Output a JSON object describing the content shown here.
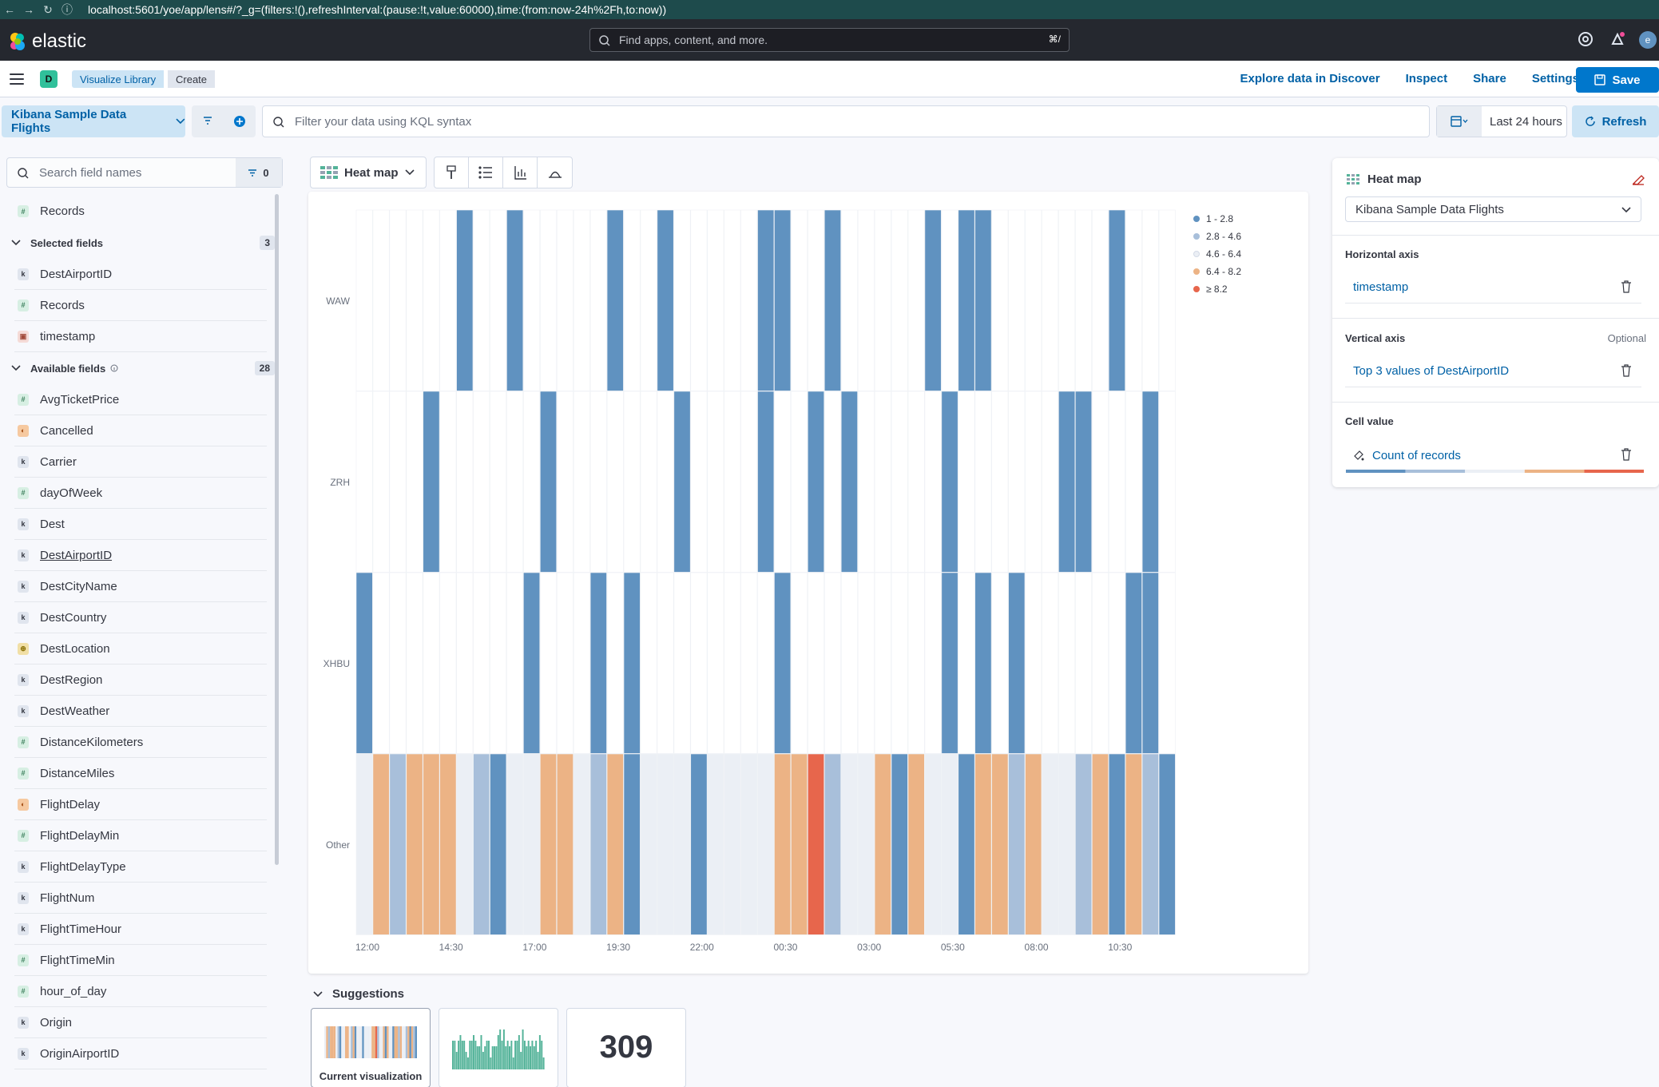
{
  "browser": {
    "host": "localhost",
    "path": ":5601/yoe/app/lens#/?_g=(filters:!(),refreshInterval:(pause:!t,value:60000),time:(from:now-24h%2Fh,to:now))"
  },
  "header": {
    "brand": "elastic",
    "search_placeholder": "Find apps, content, and more.",
    "search_shortcut": "⌘/"
  },
  "app_bar": {
    "space_initial": "D",
    "breadcrumbs": [
      "Visualize Library",
      "Create"
    ],
    "links": [
      "Explore data in Discover",
      "Inspect",
      "Share",
      "Settings"
    ],
    "save_label": "Save"
  },
  "query_bar": {
    "data_view": "Kibana Sample Data Flights",
    "kql_placeholder": "Filter your data using KQL syntax",
    "time_range": "Last 24 hours",
    "refresh_label": "Refresh"
  },
  "sidebar": {
    "search_placeholder": "Search field names",
    "filter_count": "0",
    "records_label": "Records",
    "selected": {
      "title": "Selected fields",
      "count": "3",
      "fields": [
        {
          "name": "DestAirportID",
          "type": "k"
        },
        {
          "name": "Records",
          "type": "n"
        },
        {
          "name": "timestamp",
          "type": "d"
        }
      ]
    },
    "available": {
      "title": "Available fields",
      "count": "28",
      "fields": [
        {
          "name": "AvgTicketPrice",
          "type": "n"
        },
        {
          "name": "Cancelled",
          "type": "b"
        },
        {
          "name": "Carrier",
          "type": "k"
        },
        {
          "name": "dayOfWeek",
          "type": "n"
        },
        {
          "name": "Dest",
          "type": "k"
        },
        {
          "name": "DestAirportID",
          "type": "k"
        },
        {
          "name": "DestCityName",
          "type": "k"
        },
        {
          "name": "DestCountry",
          "type": "k"
        },
        {
          "name": "DestLocation",
          "type": "g"
        },
        {
          "name": "DestRegion",
          "type": "k"
        },
        {
          "name": "DestWeather",
          "type": "k"
        },
        {
          "name": "DistanceKilometers",
          "type": "n"
        },
        {
          "name": "DistanceMiles",
          "type": "n"
        },
        {
          "name": "FlightDelay",
          "type": "b"
        },
        {
          "name": "FlightDelayMin",
          "type": "n"
        },
        {
          "name": "FlightDelayType",
          "type": "k"
        },
        {
          "name": "FlightNum",
          "type": "k"
        },
        {
          "name": "FlightTimeHour",
          "type": "k"
        },
        {
          "name": "FlightTimeMin",
          "type": "n"
        },
        {
          "name": "hour_of_day",
          "type": "n"
        },
        {
          "name": "Origin",
          "type": "k"
        },
        {
          "name": "OriginAirportID",
          "type": "k"
        }
      ]
    }
  },
  "toolbar": {
    "vis_type": "Heat map"
  },
  "chart_data": {
    "type": "heatmap",
    "y_categories": [
      "WAW",
      "ZRH",
      "XHBU",
      "Other"
    ],
    "x_ticks": [
      "12:00",
      "14:30",
      "17:00",
      "19:30",
      "22:00",
      "00:30",
      "03:00",
      "05:30",
      "08:00",
      "10:30"
    ],
    "columns": 49,
    "legend": [
      {
        "label": "1 - 2.8",
        "color": "#6092c0"
      },
      {
        "label": "2.8 - 4.6",
        "color": "#a8bfda"
      },
      {
        "label": "4.6 - 6.4",
        "color": "#ebeff5"
      },
      {
        "label": "6.4 - 8.2",
        "color": "#ecb385"
      },
      {
        "label": "≥ 8.2",
        "color": "#e7664c"
      }
    ],
    "cells": {
      "WAW": [
        0,
        0,
        0,
        0,
        0,
        0,
        1,
        0,
        0,
        1,
        0,
        0,
        0,
        0,
        0,
        1,
        0,
        0,
        1,
        0,
        0,
        0,
        0,
        0,
        1,
        1,
        0,
        0,
        1,
        0,
        0,
        0,
        0,
        0,
        1,
        0,
        1,
        1,
        0,
        0,
        0,
        0,
        0,
        0,
        0,
        1,
        0,
        0,
        0
      ],
      "ZRH": [
        0,
        0,
        0,
        0,
        1,
        0,
        0,
        0,
        0,
        0,
        0,
        1,
        0,
        0,
        0,
        0,
        0,
        0,
        0,
        1,
        0,
        0,
        0,
        0,
        1,
        0,
        0,
        1,
        0,
        1,
        0,
        0,
        0,
        0,
        0,
        1,
        0,
        0,
        0,
        0,
        0,
        0,
        1,
        1,
        0,
        0,
        0,
        1,
        0
      ],
      "XHBU": [
        1,
        0,
        0,
        0,
        0,
        0,
        0,
        0,
        0,
        0,
        1,
        0,
        0,
        0,
        1,
        0,
        1,
        0,
        0,
        0,
        0,
        0,
        0,
        0,
        0,
        1,
        0,
        0,
        0,
        0,
        0,
        0,
        0,
        0,
        0,
        1,
        0,
        1,
        0,
        1,
        0,
        0,
        0,
        0,
        0,
        0,
        1,
        1,
        0
      ],
      "Other": [
        3,
        4,
        2,
        4,
        4,
        4,
        3,
        2,
        1,
        3,
        3,
        4,
        4,
        3,
        2,
        4,
        1,
        3,
        3,
        3,
        1,
        3,
        3,
        3,
        3,
        4,
        4,
        5,
        2,
        3,
        3,
        4,
        1,
        4,
        3,
        3,
        1,
        4,
        4,
        2,
        4,
        3,
        3,
        2,
        4,
        1,
        4,
        2,
        1
      ]
    }
  },
  "suggestions": {
    "title": "Suggestions",
    "current_label": "Current visualization",
    "metric_value": "309"
  },
  "config": {
    "vis_title": "Heat map",
    "data_view": "Kibana Sample Data Flights",
    "horizontal": {
      "title": "Horizontal axis",
      "value": "timestamp"
    },
    "vertical": {
      "title": "Vertical axis",
      "optional": "Optional",
      "value": "Top 3 values of DestAirportID"
    },
    "cell": {
      "title": "Cell value",
      "value": "Count of records"
    }
  }
}
